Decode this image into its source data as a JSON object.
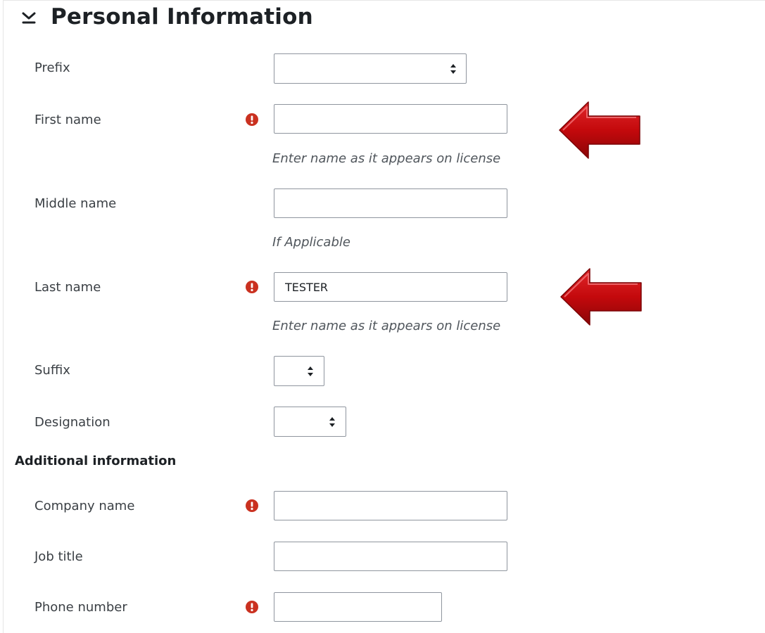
{
  "section": {
    "title": "Personal Information",
    "collapse_icon": "chevron-down-icon"
  },
  "fields": {
    "prefix": {
      "label": "Prefix",
      "value": ""
    },
    "first_name": {
      "label": "First name",
      "value": "",
      "required_icon": "exclamation-circle-icon",
      "help": "Enter name as it appears on license"
    },
    "middle_name": {
      "label": "Middle name",
      "value": "",
      "help": "If Applicable"
    },
    "last_name": {
      "label": "Last name",
      "value": "TESTER",
      "required_icon": "exclamation-circle-icon",
      "help": "Enter name as it appears on license"
    },
    "suffix": {
      "label": "Suffix",
      "value": ""
    },
    "designation": {
      "label": "Designation",
      "value": ""
    }
  },
  "additional": {
    "heading": "Additional information",
    "company_name": {
      "label": "Company name",
      "value": "",
      "required_icon": "exclamation-circle-icon"
    },
    "job_title": {
      "label": "Job title",
      "value": ""
    },
    "phone_number": {
      "label": "Phone number",
      "value": "",
      "required_icon": "exclamation-circle-icon"
    }
  },
  "colors": {
    "required": "#ca3120",
    "annotation_arrow": "#c4090c",
    "text": "#1d2125",
    "border": "#8f959e"
  },
  "annotations": {
    "arrow_icon": "left-arrow-icon"
  }
}
